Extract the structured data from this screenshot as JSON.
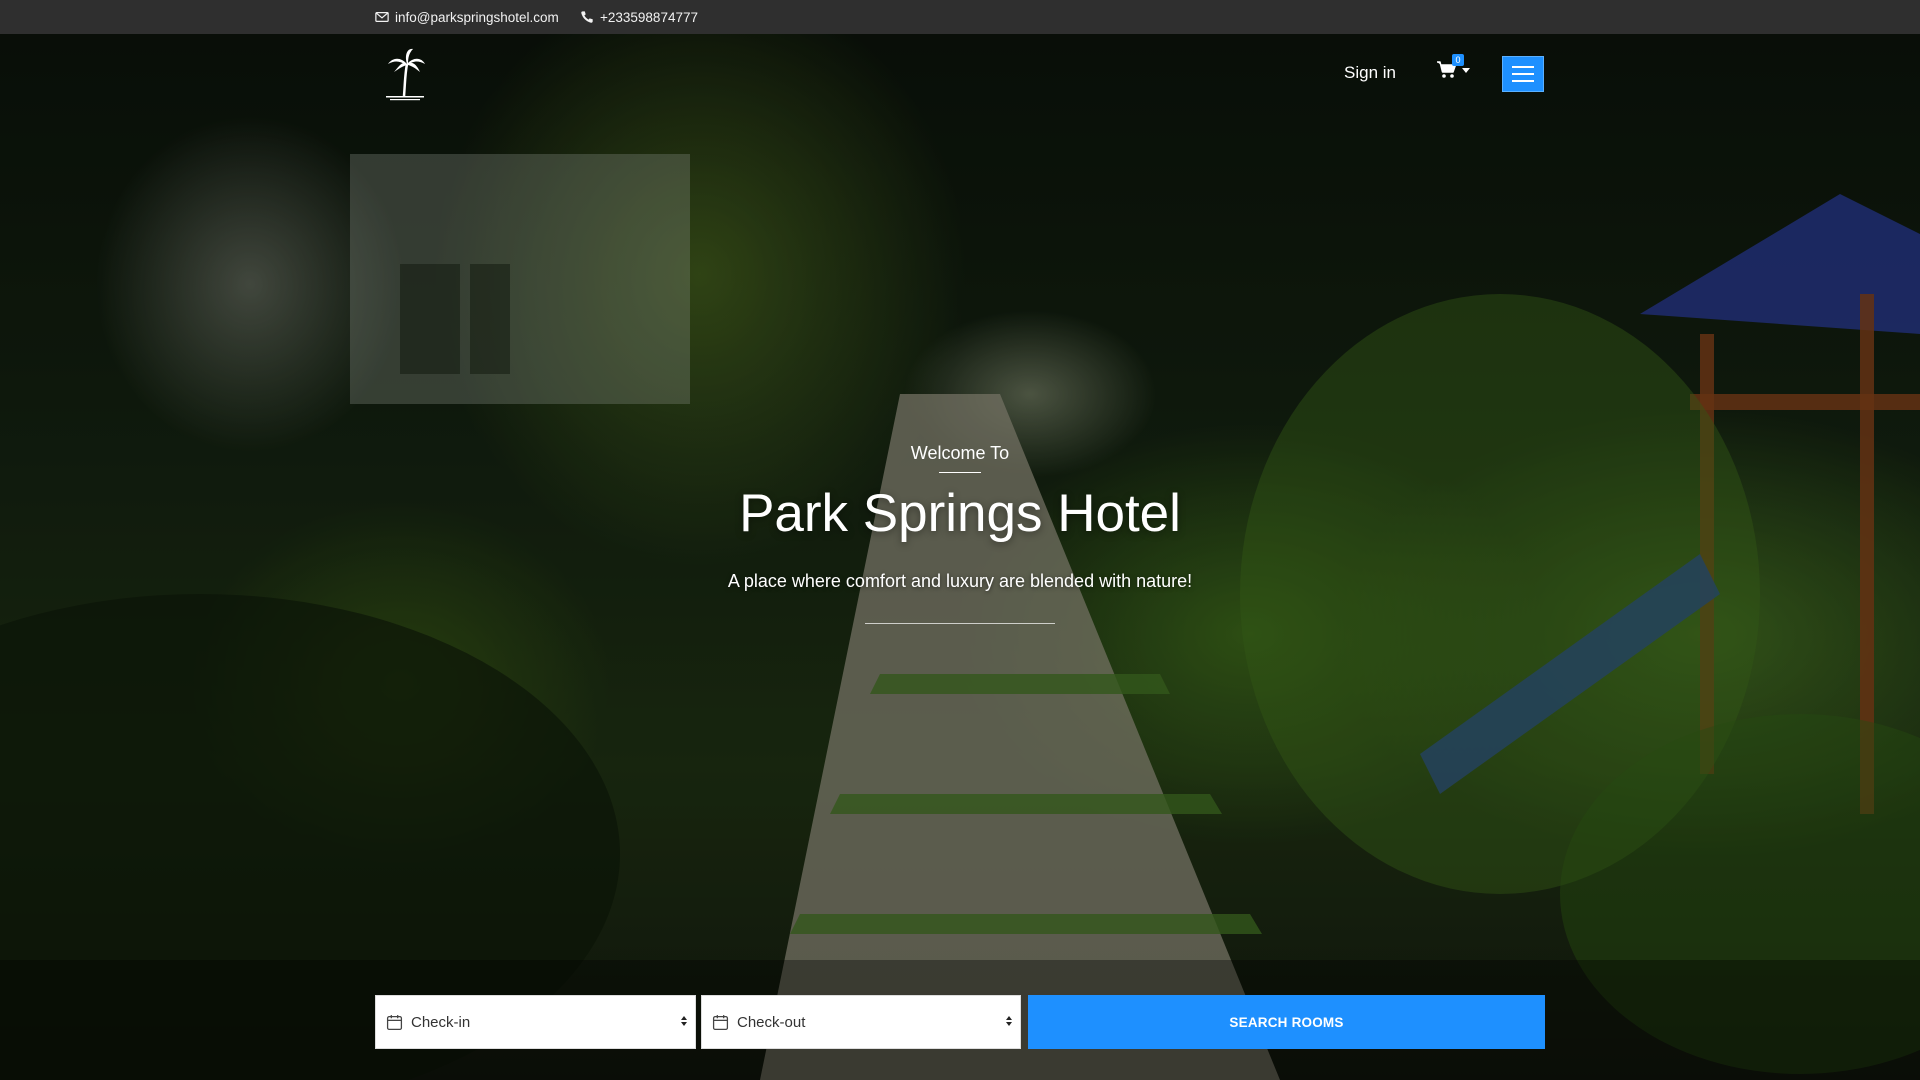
{
  "topbar": {
    "email": "info@parkspringshotel.com",
    "phone": "+233598874777",
    "email_icon": "envelope-icon",
    "phone_icon": "phone-icon"
  },
  "navbar": {
    "logo": "palm-tree-logo",
    "signin_label": "Sign in",
    "cart_count": "0",
    "cart_icon": "cart-icon",
    "menu_icon": "hamburger-menu-icon"
  },
  "hero": {
    "welcome": "Welcome To",
    "title": "Park Springs Hotel",
    "tagline": "A place where comfort and luxury are blended with nature!"
  },
  "booking": {
    "checkin_placeholder": "Check-in",
    "checkout_placeholder": "Check-out",
    "search_label": "SEARCH ROOMS",
    "calendar_icon": "calendar-icon"
  },
  "colors": {
    "accent": "#1e90ff",
    "topbar_bg": "#2f2f2f"
  }
}
